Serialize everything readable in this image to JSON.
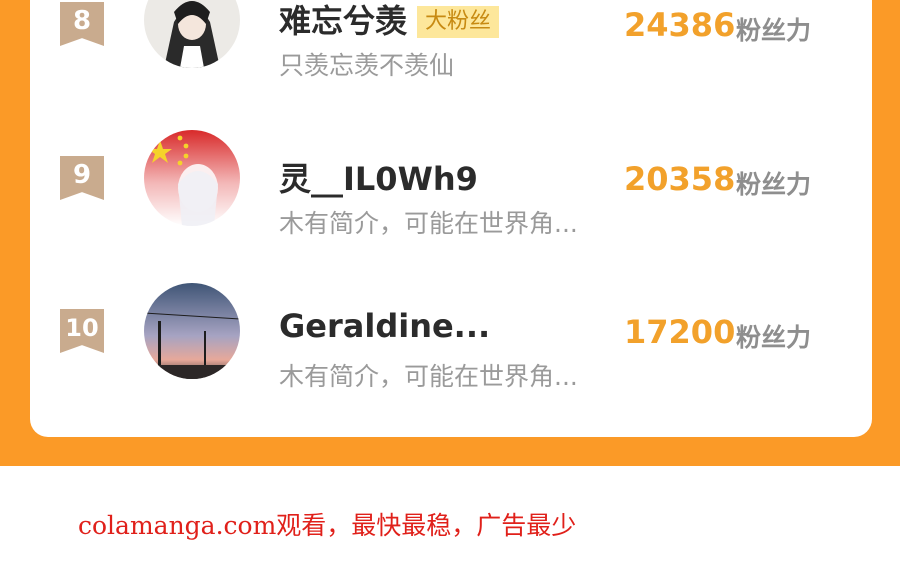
{
  "ranking": {
    "entries": [
      {
        "rank": "8",
        "name": "难忘兮羡",
        "badge": "大粉丝",
        "bio": "只羡忘羡不羡仙",
        "score": "24386",
        "score_label": "粉丝力",
        "avatar_icon": "anime-girl-avatar"
      },
      {
        "rank": "9",
        "name": "灵__IL0Wh9",
        "badge": "",
        "bio": "木有简介，可能在世界角...",
        "score": "20358",
        "score_label": "粉丝力",
        "avatar_icon": "flag-avatar"
      },
      {
        "rank": "10",
        "name": "Geraldine...",
        "badge": "",
        "bio": "木有简介，可能在世界角...",
        "score": "17200",
        "score_label": "粉丝力",
        "avatar_icon": "sky-photo-avatar"
      }
    ],
    "colors": {
      "background": "#fb9a27",
      "score": "#f2a12b",
      "rank_badge": "#c9ab8e",
      "fan_tag_bg": "#fde79b"
    }
  },
  "footer": {
    "watermark": "colamanga.com观看，最快最稳，广告最少",
    "color": "#e0201a"
  }
}
